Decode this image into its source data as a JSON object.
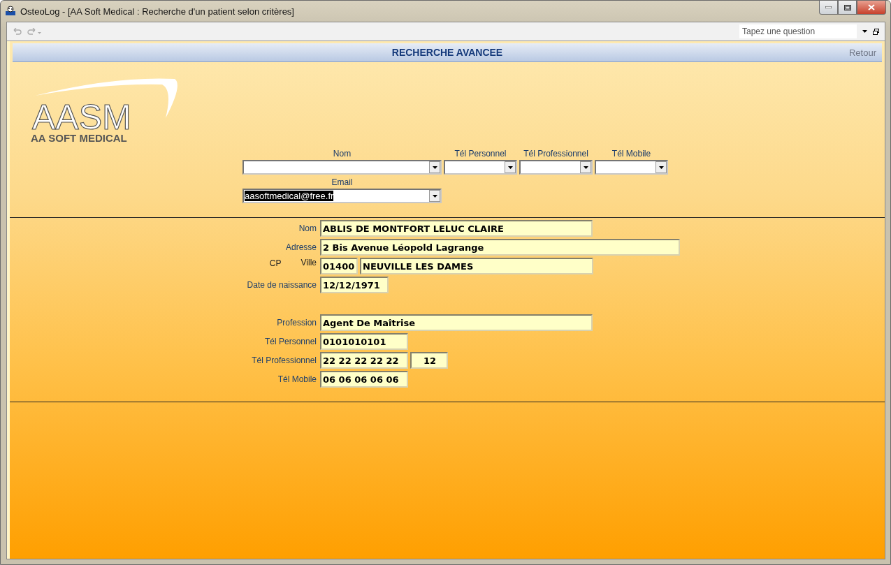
{
  "window": {
    "title": "OsteoLog - [AA Soft Medical : Recherche d'un patient selon critères]"
  },
  "toolbar": {
    "question_placeholder": "Tapez une question"
  },
  "header": {
    "title": "RECHERCHE AVANCEE",
    "back_link": "Retour"
  },
  "logo": {
    "mark": "AASM",
    "name": "AA SOFT MEDICAL"
  },
  "search": {
    "fields": [
      {
        "label": "Nom"
      },
      {
        "label": "Tél Personnel"
      },
      {
        "label": "Tél Professionnel"
      },
      {
        "label": "Tél Mobile"
      }
    ],
    "email": {
      "label": "Email",
      "value": "aasoftmedical@free.fr",
      "text_selected": true
    }
  },
  "identity": [
    {
      "labels": [
        "Nom"
      ],
      "values": [
        "ABLIS DE MONTFORT LELUC CLAIRE"
      ]
    },
    {
      "labels": [
        "Adresse"
      ],
      "values": [
        "2 Bis Avenue Léopold Lagrange"
      ]
    },
    {
      "labels": [
        "CP",
        "Ville"
      ],
      "values": [
        "01400",
        "NEUVILLE LES DAMES"
      ]
    },
    {
      "labels": [
        "Date de naissance"
      ],
      "values": [
        "12/12/1971"
      ]
    }
  ],
  "contact": [
    {
      "labels": [
        "Profession"
      ],
      "values": [
        "Agent De Maîtrise"
      ]
    },
    {
      "labels": [
        "Tél Personnel"
      ],
      "values": [
        "0101010101"
      ]
    },
    {
      "labels": [
        "Tél Professionnel"
      ],
      "values": [
        "22 22 22 22 22",
        "12"
      ]
    },
    {
      "labels": [
        "Tél Mobile"
      ],
      "values": [
        "06 06 06 06 06"
      ]
    }
  ]
}
